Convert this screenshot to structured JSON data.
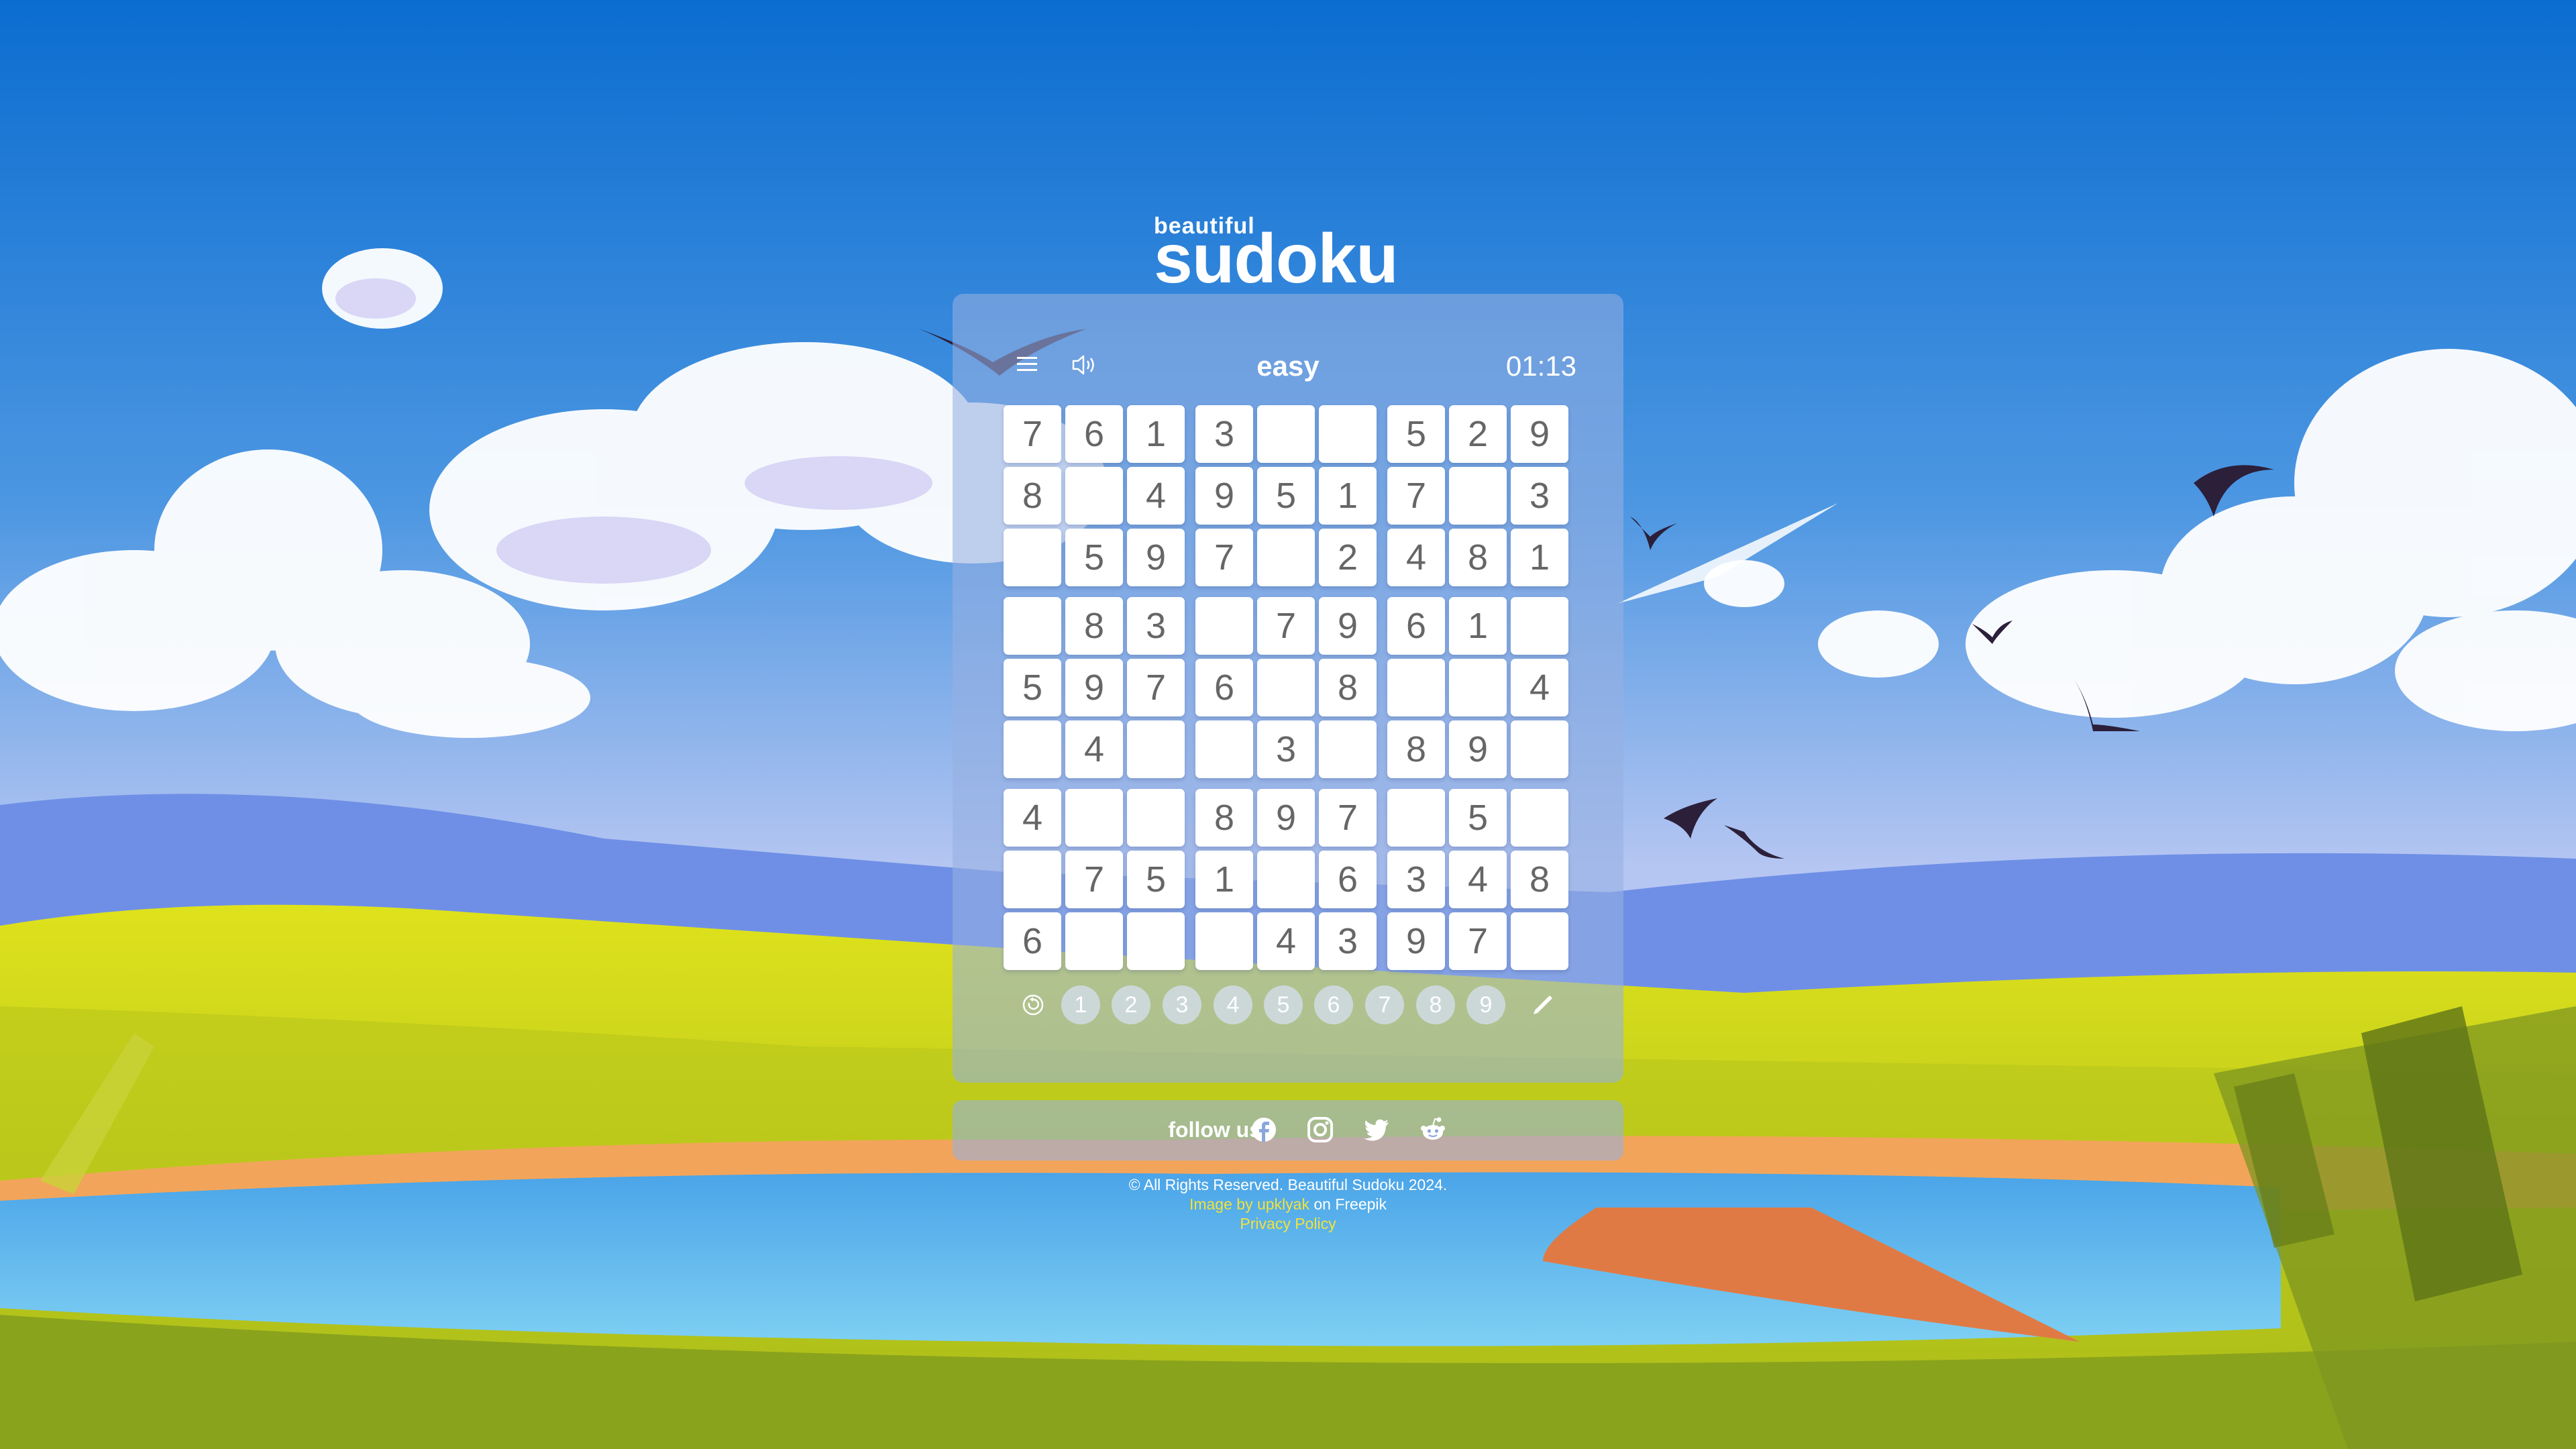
{
  "logo": {
    "small": "beautiful",
    "big": "sudoku"
  },
  "header": {
    "difficulty": "easy",
    "timer": "01:13"
  },
  "board": [
    [
      "7",
      "6",
      "1",
      "3",
      "",
      "",
      "5",
      "2",
      "9"
    ],
    [
      "8",
      "",
      "4",
      "9",
      "5",
      "1",
      "7",
      "",
      "3"
    ],
    [
      "",
      "5",
      "9",
      "7",
      "",
      "2",
      "4",
      "8",
      "1"
    ],
    [
      "",
      "8",
      "3",
      "",
      "7",
      "9",
      "6",
      "1",
      ""
    ],
    [
      "5",
      "9",
      "7",
      "6",
      "",
      "8",
      "",
      "",
      "4"
    ],
    [
      "",
      "4",
      "",
      "",
      "3",
      "",
      "8",
      "9",
      ""
    ],
    [
      "4",
      "",
      "",
      "8",
      "9",
      "7",
      "",
      "5",
      ""
    ],
    [
      "",
      "7",
      "5",
      "1",
      "",
      "6",
      "3",
      "4",
      "8"
    ],
    [
      "6",
      "",
      "",
      "",
      "4",
      "3",
      "9",
      "7",
      ""
    ]
  ],
  "number_pad": [
    "1",
    "2",
    "3",
    "4",
    "5",
    "6",
    "7",
    "8",
    "9"
  ],
  "icons": {
    "menu": "menu-icon",
    "sound": "speaker-icon",
    "erase": "erase-icon",
    "pencil": "pencil-icon",
    "facebook": "facebook-icon",
    "instagram": "instagram-icon",
    "twitter": "twitter-icon",
    "reddit": "reddit-icon"
  },
  "follow": {
    "label": "follow us"
  },
  "footer": {
    "copyright": "© All Rights Reserved. Beautiful Sudoku 2024.",
    "credit_prefix": "Image by",
    "credit_author": "upklyak",
    "credit_suffix": "on Freepik",
    "privacy": "Privacy Policy"
  },
  "colors": {
    "accent": "#f2e23a",
    "cell_text": "#666666",
    "panel": "#96afe1"
  }
}
